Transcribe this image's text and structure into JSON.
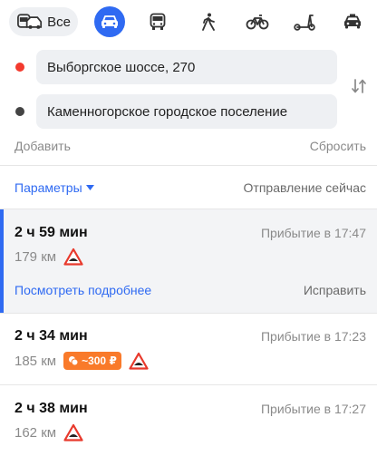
{
  "modes": {
    "all_label": "Все",
    "items": [
      {
        "id": "car",
        "icon": "car-icon",
        "active": true
      },
      {
        "id": "bus",
        "icon": "bus-icon"
      },
      {
        "id": "walk",
        "icon": "pedestrian-icon"
      },
      {
        "id": "bike",
        "icon": "bicycle-icon"
      },
      {
        "id": "scooter",
        "icon": "scooter-icon"
      },
      {
        "id": "taxi",
        "icon": "taxi-icon"
      }
    ]
  },
  "route_form": {
    "from": "Выборгское шоссе, 270",
    "to": "Каменногорское городское поселение",
    "add_label": "Добавить",
    "reset_label": "Сбросить"
  },
  "options": {
    "params_label": "Параметры",
    "departure_label": "Отправление сейчас"
  },
  "routes": [
    {
      "duration": "2 ч 59 мин",
      "arrival": "Прибытие в 17:47",
      "distance": "179 км",
      "details_label": "Посмотреть подробнее",
      "fix_label": "Исправить"
    },
    {
      "duration": "2 ч 34 мин",
      "arrival": "Прибытие в 17:23",
      "distance": "185 км",
      "toll": "~300 ₽"
    },
    {
      "duration": "2 ч 38 мин",
      "arrival": "Прибытие в 17:27",
      "distance": "162 км"
    }
  ],
  "colors": {
    "accent": "#2f6af2",
    "from_dot": "#f33a2e",
    "toll": "#f97a2a",
    "warning": "#e8392c"
  }
}
